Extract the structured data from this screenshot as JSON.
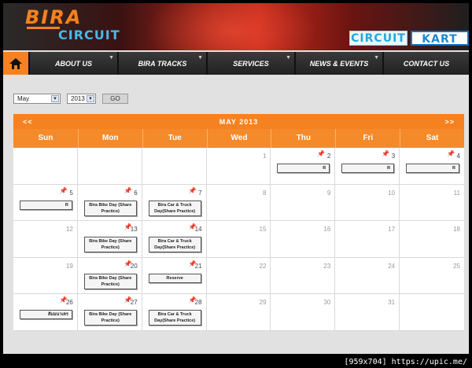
{
  "header": {
    "logo_top": "BIRA",
    "logo_bottom": "CIRCUIT",
    "badge_circuit": "CIRCUIT",
    "badge_kart": "KART"
  },
  "nav": {
    "home_icon": "home-icon",
    "items": [
      "ABOUT US",
      "BIRA TRACKS",
      "SERVICES",
      "NEWS & EVENTS",
      "CONTACT US"
    ],
    "caret": "▼"
  },
  "controls": {
    "month": "May",
    "year": "2013",
    "go_label": "GO"
  },
  "calendar": {
    "prev": "<<",
    "next": ">>",
    "title": "MAY 2013",
    "days": [
      "Sun",
      "Mon",
      "Tue",
      "Wed",
      "Thu",
      "Fri",
      "Sat"
    ],
    "cells": [
      {
        "day": "",
        "event": ""
      },
      {
        "day": "",
        "event": ""
      },
      {
        "day": "",
        "event": ""
      },
      {
        "day": "1",
        "event": ""
      },
      {
        "day": "2",
        "event": "R",
        "pin": true
      },
      {
        "day": "3",
        "event": "R",
        "pin": true
      },
      {
        "day": "4",
        "event": "R",
        "pin": true
      },
      {
        "day": "5",
        "event": "R",
        "pin": true
      },
      {
        "day": "6",
        "event": "Bira Bike Day (Share Practice)",
        "pin": true
      },
      {
        "day": "7",
        "event": "Bira Car & Truck Day(Share Practice)",
        "pin": true
      },
      {
        "day": "8",
        "event": ""
      },
      {
        "day": "9",
        "event": ""
      },
      {
        "day": "10",
        "event": ""
      },
      {
        "day": "11",
        "event": ""
      },
      {
        "day": "12",
        "event": ""
      },
      {
        "day": "13",
        "event": "Bira Bike Day (Share Practice)",
        "pin": true
      },
      {
        "day": "14",
        "event": "Bira Car & Truck Day(Share Practice)",
        "pin": true
      },
      {
        "day": "15",
        "event": ""
      },
      {
        "day": "16",
        "event": ""
      },
      {
        "day": "17",
        "event": ""
      },
      {
        "day": "18",
        "event": ""
      },
      {
        "day": "19",
        "event": ""
      },
      {
        "day": "20",
        "event": "Bira Bike Day (Share Practice)",
        "pin": true
      },
      {
        "day": "21",
        "event": "Reserve",
        "pin": true
      },
      {
        "day": "22",
        "event": ""
      },
      {
        "day": "23",
        "event": ""
      },
      {
        "day": "24",
        "event": ""
      },
      {
        "day": "25",
        "event": ""
      },
      {
        "day": "26",
        "event": "สัมมนาเคร",
        "pin": true
      },
      {
        "day": "27",
        "event": "Bira Bike Day (Share Practice)",
        "pin": true
      },
      {
        "day": "28",
        "event": "Bira Car & Truck Day(Share Practice)",
        "pin": true
      },
      {
        "day": "29",
        "event": ""
      },
      {
        "day": "30",
        "event": ""
      },
      {
        "day": "31",
        "event": ""
      },
      {
        "day": "",
        "event": ""
      }
    ]
  },
  "watermark": "[959x704] https://upic.me/"
}
